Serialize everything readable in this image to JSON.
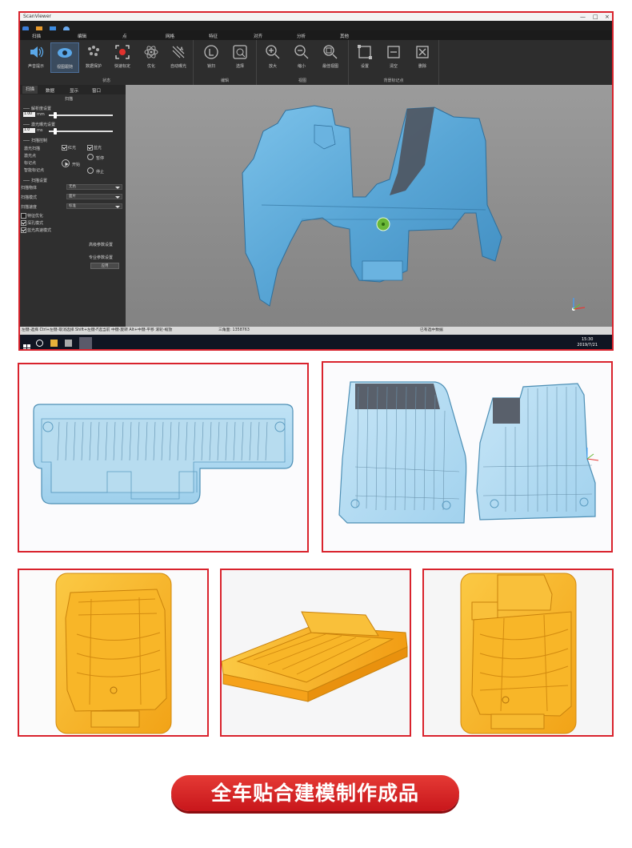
{
  "window": {
    "title": "ScanViewer",
    "controls": [
      "—",
      "□",
      "×"
    ]
  },
  "menu": [
    "扫描",
    "编辑",
    "点",
    "网格",
    "特征",
    "对齐",
    "分析",
    "其他"
  ],
  "ribbon": {
    "groups": [
      {
        "name": "状态",
        "buttons": [
          {
            "label": "声音提示",
            "icon": "speaker-icon"
          },
          {
            "label": "视图跟随",
            "icon": "eye-icon",
            "active": true
          },
          {
            "label": "数据保护",
            "icon": "data-protect-icon"
          },
          {
            "label": "快速标定",
            "icon": "target-icon"
          },
          {
            "label": "优化",
            "icon": "atom-icon"
          },
          {
            "label": "自动曝光",
            "icon": "exposure-icon"
          }
        ]
      },
      {
        "name": "编辑",
        "buttons": [
          {
            "label": "锁扫",
            "icon": "lock-scan-icon"
          },
          {
            "label": "选择",
            "icon": "select-icon"
          }
        ]
      },
      {
        "name": "视图",
        "buttons": [
          {
            "label": "放大",
            "icon": "zoom-in-icon"
          },
          {
            "label": "缩小",
            "icon": "zoom-out-icon"
          },
          {
            "label": "最佳视图",
            "icon": "zoom-fit-icon"
          }
        ]
      },
      {
        "name": "背景标记点",
        "buttons": [
          {
            "label": "设置",
            "icon": "frame-icon"
          },
          {
            "label": "清空",
            "icon": "clear-icon"
          },
          {
            "label": "删除",
            "icon": "delete-icon"
          }
        ]
      }
    ]
  },
  "panel": {
    "tabs": [
      "扫描",
      "数据",
      "显示",
      "窗口"
    ],
    "header": "扫描",
    "resolution": {
      "title": "解析度设置",
      "value": "1.00",
      "unit": "mm"
    },
    "exposure": {
      "title": "激光曝光设置",
      "value": "1.0",
      "unit": "ms"
    },
    "scan_control": {
      "title": "扫描控制",
      "options": [
        "激光扫描",
        "激光点",
        "标记点",
        "智能标记点"
      ],
      "red_light": "红光",
      "blue_light": "蓝光",
      "start": "开始",
      "pause": "暂停",
      "stop": "停止"
    },
    "scan_settings": {
      "title": "扫描设置",
      "rows": [
        {
          "label": "扫描物体",
          "value": "无色"
        },
        {
          "label": "扫描模式",
          "value": "面片"
        },
        {
          "label": "扫描速度",
          "value": "标准"
        }
      ],
      "checks": [
        {
          "label": "特征优化",
          "checked": false
        },
        {
          "label": "深孔模式",
          "checked": true
        },
        {
          "label": "蓝光高速模式",
          "checked": true
        }
      ],
      "advanced": "高级参数设置",
      "expert": "专业参数设置",
      "apply": "应用"
    }
  },
  "statusbar": {
    "hint": "左键-选择 Ctrl+左键-取消选择 Shift+左键-F选当前 中键-旋转 Alt+中键-平移 滚轮-缩放",
    "triangles": "三角面: 1358763",
    "selected": "已有选中数据"
  },
  "taskbar": {
    "time": "15:30",
    "date": "2019/7/21"
  },
  "caption": "全车贴合建模制作成品",
  "colors": {
    "scan_blue": "#5aa6d6",
    "accent_red": "#d9232d",
    "mold_yellow": "#f4b320"
  }
}
